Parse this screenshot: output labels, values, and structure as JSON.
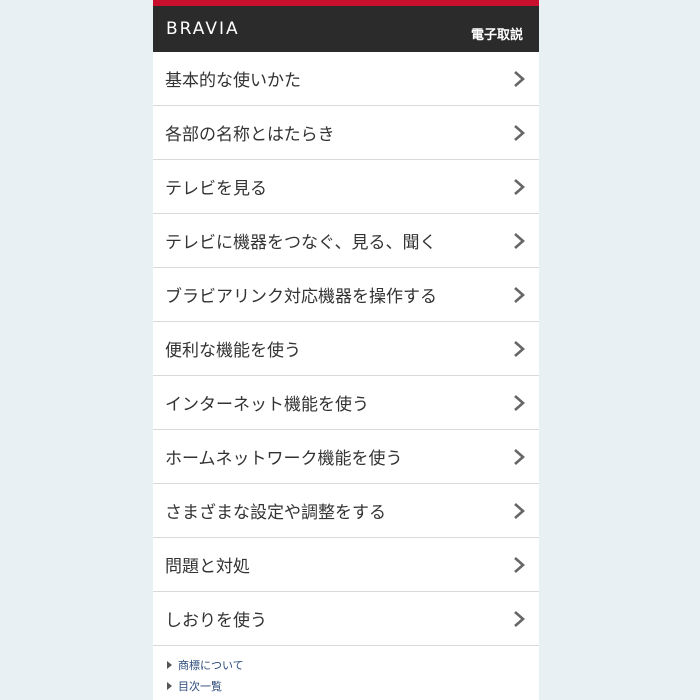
{
  "header": {
    "brand": "BRAVIA",
    "title": "電子取説"
  },
  "menu": [
    {
      "label": "基本的な使いかた"
    },
    {
      "label": "各部の名称とはたらき"
    },
    {
      "label": "テレビを見る"
    },
    {
      "label": "テレビに機器をつなぐ、見る、聞く"
    },
    {
      "label": "ブラビアリンク対応機器を操作する"
    },
    {
      "label": "便利な機能を使う"
    },
    {
      "label": "インターネット機能を使う"
    },
    {
      "label": "ホームネットワーク機能を使う"
    },
    {
      "label": "さまざまな設定や調整をする"
    },
    {
      "label": "問題と対処"
    },
    {
      "label": "しおりを使う"
    }
  ],
  "footer": {
    "links": [
      {
        "label": "商標について"
      },
      {
        "label": "目次一覧"
      }
    ]
  },
  "colors": {
    "accent": "#c8102e",
    "header_bg": "#2b2b2b",
    "page_bg": "#e9f0f4"
  },
  "icons": {
    "menu_arrow": "chevron-right-icon",
    "footer_bullet": "triangle-right-icon"
  }
}
